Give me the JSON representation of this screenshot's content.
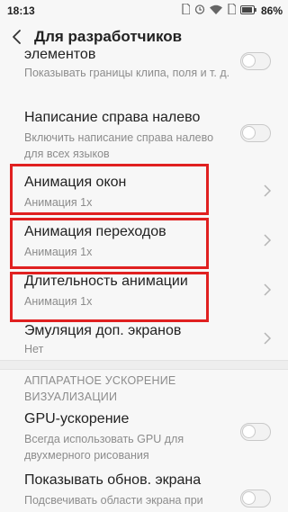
{
  "status_bar": {
    "time": "18:13",
    "battery_percent": "86%",
    "icons": [
      "sim-icon",
      "alarm-icon",
      "wifi-icon",
      "sim-card-icon",
      "battery-icon"
    ]
  },
  "toolbar": {
    "title": "Для разработчиков"
  },
  "rows": {
    "elements": {
      "title": "элементов",
      "subtitle": "Показывать границы клипа, поля и т. д."
    },
    "rtl": {
      "title": "Написание справа налево",
      "subtitle": "Включить написание справа налево для всех языков"
    },
    "window_anim": {
      "title": "Анимация окон",
      "subtitle": "Анимация 1x"
    },
    "transition_anim": {
      "title": "Анимация переходов",
      "subtitle": "Анимация 1x"
    },
    "anim_duration": {
      "title": "Длительность анимации",
      "subtitle": "Анимация 1x"
    },
    "secondary_displays": {
      "title": "Эмуляция доп. экранов",
      "subtitle": "Нет"
    },
    "gpu": {
      "title": "GPU-ускорение",
      "subtitle": "Всегда использовать GPU для двухмерного рисования"
    },
    "surface_updates": {
      "title": "Показывать обнов. экрана",
      "subtitle": "Подсвечивать области экрана при"
    }
  },
  "section": {
    "hw_accel": "АППАРАТНОЕ УСКОРЕНИЕ ВИЗУАЛИЗАЦИИ"
  },
  "colors": {
    "highlight": "#e02020",
    "background": "#f7f7f7",
    "subtitle": "#8c8c8c"
  }
}
